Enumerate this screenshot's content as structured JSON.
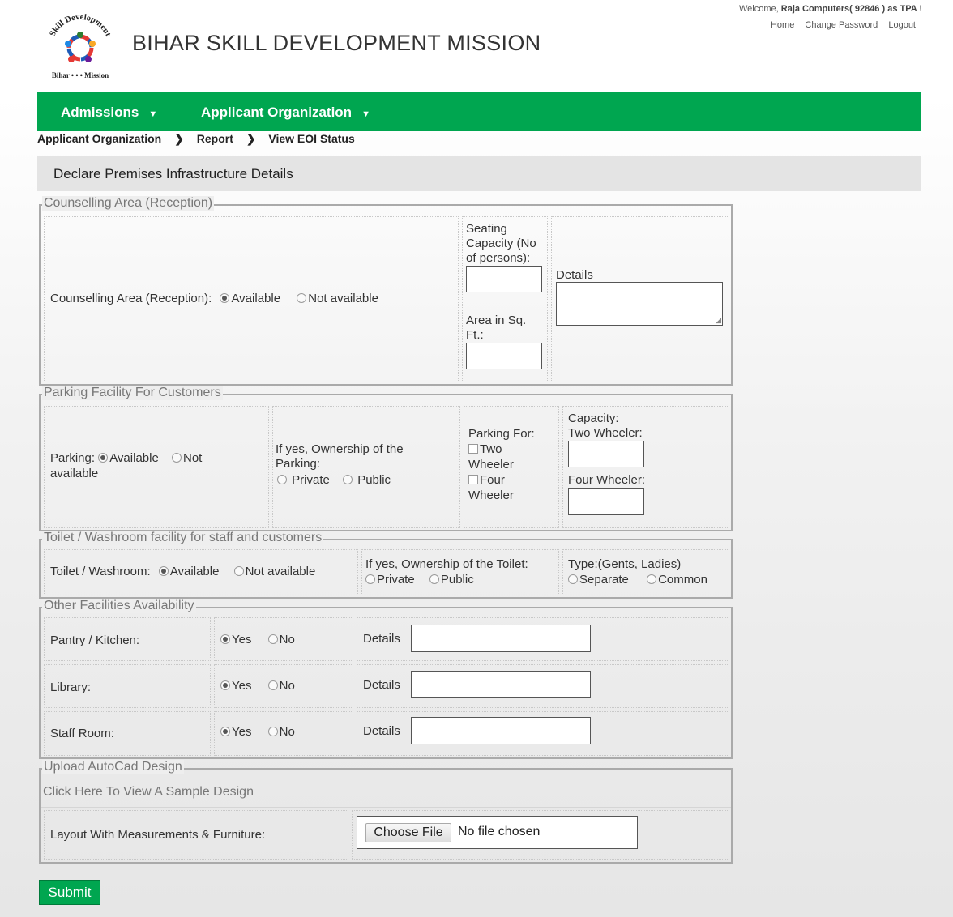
{
  "header": {
    "brand": "BIHAR SKILL DEVELOPMENT MISSION",
    "logo_text": "Bihar Skill Development Mission",
    "welcome_prefix": "Welcome, ",
    "welcome_user": "Raja Computers( 92846 ) as TPA !",
    "links": [
      "Home",
      "Change Password",
      "Logout"
    ]
  },
  "nav": {
    "items": [
      "Admissions",
      "Applicant Organization"
    ],
    "color": "#00a650"
  },
  "breadcrumb": [
    "Applicant Organization",
    "Report",
    "View EOI Status"
  ],
  "page_title": "Declare Premises Infrastructure Details",
  "counselling": {
    "legend": "Counselling Area (Reception)",
    "label": "Counselling Area (Reception):",
    "opt_available": "Available",
    "opt_not": "Not available",
    "seating_label": "Seating Capacity (No of persons):",
    "area_label": "Area in Sq. Ft.:",
    "details_label": "Details"
  },
  "parking": {
    "legend": "Parking Facility For Customers",
    "label": "Parking:",
    "opt_available": "Available",
    "opt_not": "Not available",
    "ownership_label": "If yes, Ownership of the Parking:",
    "opt_private": "Private",
    "opt_public": "Public",
    "for_label": "Parking For:",
    "opt_two": "Two Wheeler",
    "opt_four": "Four Wheeler",
    "capacity_label": "Capacity:",
    "two_label": "Two Wheeler:",
    "four_label": "Four Wheeler:"
  },
  "toilet": {
    "legend": "Toilet / Washroom facility for staff and customers",
    "label": "Toilet / Washroom:",
    "opt_available": "Available",
    "opt_not": "Not available",
    "ownership_label": "If yes, Ownership of the Toilet:",
    "opt_private": "Private",
    "opt_public": "Public",
    "type_label": "Type:(Gents, Ladies)",
    "opt_separate": "Separate",
    "opt_common": "Common"
  },
  "other": {
    "legend": "Other Facilities Availability",
    "rows": [
      {
        "label": "Pantry / Kitchen:",
        "yes": "Yes",
        "no": "No",
        "details": "Details"
      },
      {
        "label": "Library:",
        "yes": "Yes",
        "no": "No",
        "details": "Details"
      },
      {
        "label": "Staff Room:",
        "yes": "Yes",
        "no": "No",
        "details": "Details"
      }
    ]
  },
  "upload": {
    "legend": "Upload AutoCad Design",
    "sample_link": "Click Here To View A Sample Design",
    "label": "Layout With Measurements & Furniture:",
    "choose_button": "Choose File",
    "file_status": "No file chosen"
  },
  "submit_label": "Submit"
}
